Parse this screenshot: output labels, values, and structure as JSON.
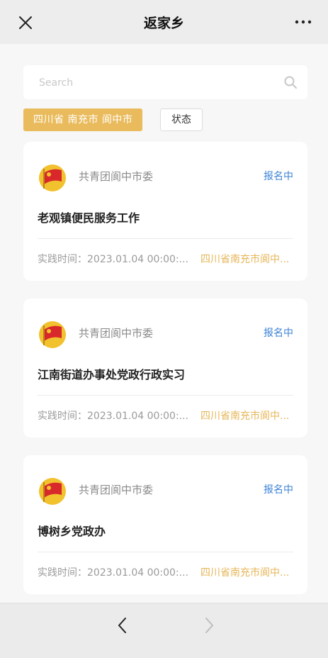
{
  "header": {
    "title": "返家乡",
    "close_icon": "close-icon",
    "more_icon": "more-horizontal-icon"
  },
  "search": {
    "placeholder": "Search",
    "icon": "search-icon"
  },
  "filters": {
    "region": "四川省 南充市 阆中市",
    "status": "状态"
  },
  "cards": [
    {
      "org": "共青团阆中市委",
      "status": "报名中",
      "title": "老观镇便民服务工作",
      "time": "实践时间：2023.01.04 00:00:...",
      "location": "四川省南充市阆中..."
    },
    {
      "org": "共青团阆中市委",
      "status": "报名中",
      "title": "江南街道办事处党政行政实习",
      "time": "实践时间：2023.01.04 00:00:...",
      "location": "四川省南充市阆中..."
    },
    {
      "org": "共青团阆中市委",
      "status": "报名中",
      "title": "博树乡党政办",
      "time": "实践时间：2023.01.04 00:00:...",
      "location": "四川省南充市阆中..."
    }
  ],
  "nav": {
    "back_icon": "chevron-left-icon",
    "forward_icon": "chevron-right-icon"
  },
  "colors": {
    "accent": "#e9bb5c",
    "status_blue": "#3b82d6",
    "location": "#e6b658"
  }
}
